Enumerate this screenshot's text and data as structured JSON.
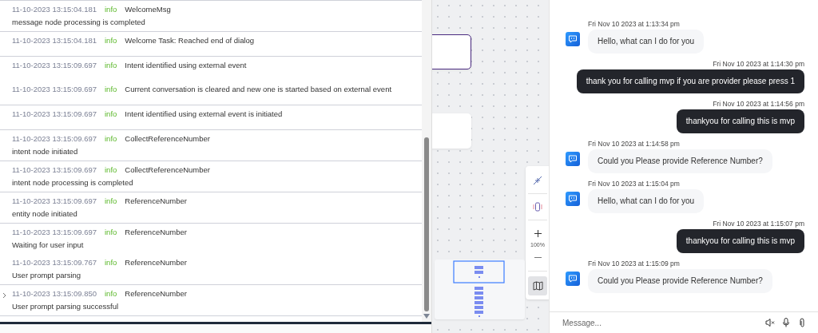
{
  "log": {
    "groups": [
      {
        "expandable": false,
        "entries": [
          {
            "time": "11-10-2023 13:15:04.181",
            "level": "info",
            "source": "WelcomeMsg",
            "message": "message node processing is completed"
          }
        ]
      },
      {
        "expandable": false,
        "entries": [
          {
            "time": "11-10-2023 13:15:04.181",
            "level": "info",
            "source": "Welcome Task: Reached end of dialog"
          }
        ]
      },
      {
        "expandable": false,
        "entries": [
          {
            "time": "11-10-2023 13:15:09.697",
            "level": "info",
            "source": "Intent identified using external event"
          },
          {
            "time": "11-10-2023 13:15:09.697",
            "level": "info",
            "source": "Current conversation is cleared and new one is started based on external event"
          }
        ]
      },
      {
        "expandable": false,
        "entries": [
          {
            "time": "11-10-2023 13:15:09.697",
            "level": "info",
            "source": "Intent identified using external event is initiated"
          }
        ]
      },
      {
        "expandable": false,
        "entries": [
          {
            "time": "11-10-2023 13:15:09.697",
            "level": "info",
            "source": "CollectReferenceNumber",
            "message": "intent node initiated"
          }
        ]
      },
      {
        "expandable": false,
        "entries": [
          {
            "time": "11-10-2023 13:15:09.697",
            "level": "info",
            "source": "CollectReferenceNumber",
            "message": "intent node processing is completed"
          }
        ]
      },
      {
        "expandable": false,
        "entries": [
          {
            "time": "11-10-2023 13:15:09.697",
            "level": "info",
            "source": "ReferenceNumber",
            "message": "entity node initiated"
          }
        ]
      },
      {
        "expandable": false,
        "entries": [
          {
            "time": "11-10-2023 13:15:09.697",
            "level": "info",
            "source": "ReferenceNumber",
            "message": "Waiting for user input"
          },
          {
            "time": "11-10-2023 13:15:09.767",
            "level": "info",
            "source": "ReferenceNumber",
            "message": "User prompt parsing"
          }
        ]
      },
      {
        "expandable": true,
        "entries": [
          {
            "time": "11-10-2023 13:15:09.850",
            "level": "info",
            "source": "ReferenceNumber",
            "message": "User prompt parsing successful"
          }
        ]
      }
    ]
  },
  "canvas": {
    "zoom": "100%",
    "minimap_on": true
  },
  "chat": {
    "messages": [
      {
        "kind": "bot",
        "time": "Fri Nov 10 2023 at 1:13:34 pm",
        "text": "Hello, what can I do for you"
      },
      {
        "kind": "user",
        "time": "Fri Nov 10 2023 at 1:14:30 pm",
        "text": "thank you for calling mvp if you are provider please press 1"
      },
      {
        "kind": "user",
        "time": "Fri Nov 10 2023 at 1:14:56 pm",
        "text": "thankyou for calling this is mvp"
      },
      {
        "kind": "bot",
        "time": "Fri Nov 10 2023 at 1:14:58 pm",
        "text": "Could you Please provide Reference Number?"
      },
      {
        "kind": "bot",
        "time": "Fri Nov 10 2023 at 1:15:04 pm",
        "text": "Hello, what can I do for you"
      },
      {
        "kind": "user",
        "time": "Fri Nov 10 2023 at 1:15:07 pm",
        "text": "thankyou for calling this is mvp"
      },
      {
        "kind": "bot",
        "time": "Fri Nov 10 2023 at 1:15:09 pm",
        "text": "Could you Please provide Reference Number?"
      }
    ],
    "composer": {
      "placeholder": "Message..."
    }
  }
}
